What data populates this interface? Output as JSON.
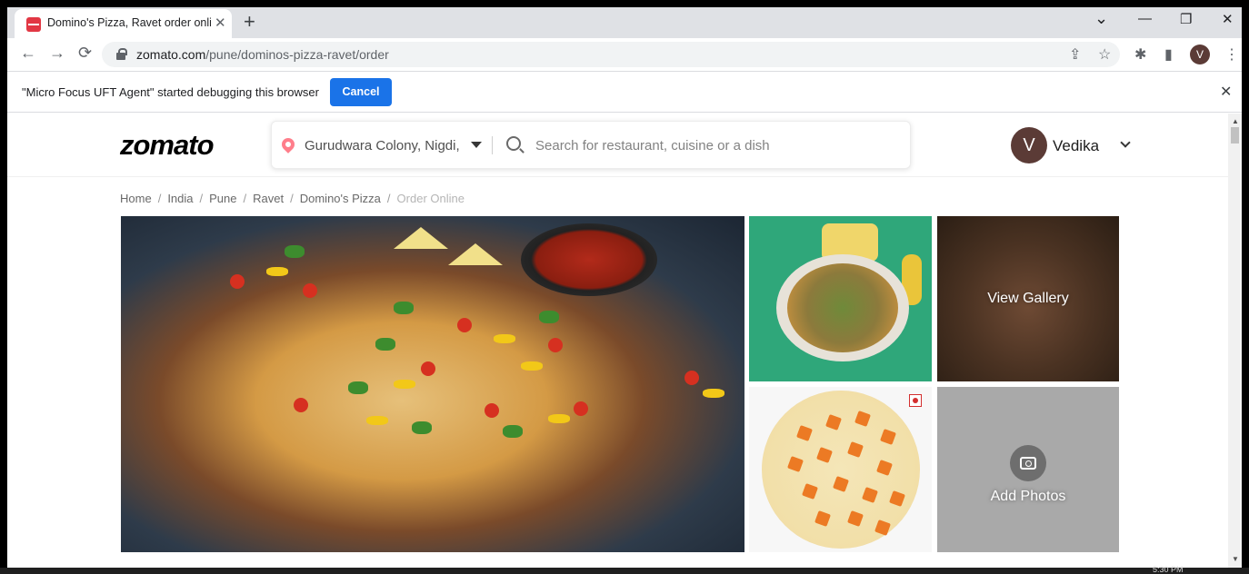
{
  "browser": {
    "tab_title": "Domino's Pizza, Ravet order online",
    "tab_close": "✕",
    "new_tab": "+",
    "window_controls": {
      "tab_search": "⌄",
      "minimize": "—",
      "restore": "❐",
      "close": "✕"
    },
    "nav": {
      "back": "←",
      "forward": "→",
      "reload": "⟳"
    },
    "url_host": "zomato.com",
    "url_path": "/pune/dominos-pizza-ravet/order",
    "toolbar_icons": [
      "share-icon",
      "bookmark-star-icon",
      "extensions-icon",
      "side-panel-icon",
      "profile-avatar",
      "menu-icon"
    ],
    "glyphs": {
      "share": "⇪",
      "star": "☆",
      "extensions": "✱",
      "side_panel": "▮",
      "menu": "⋮"
    },
    "profile_initial": "V"
  },
  "infobar": {
    "message": "\"Micro Focus UFT Agent\" started debugging this browser",
    "cancel_label": "Cancel",
    "close": "✕"
  },
  "site": {
    "logo": "zomato",
    "location": "Gurudwara Colony, Nigdi,",
    "search_placeholder": "Search for restaurant, cuisine or a dish",
    "user_initial": "V",
    "user_name": "Vedika",
    "brand_color": "#e23744"
  },
  "breadcrumb": {
    "items": [
      "Home",
      "India",
      "Pune",
      "Ravet",
      "Domino's Pizza"
    ],
    "current": "Order Online",
    "separator": "/"
  },
  "gallery": {
    "view_gallery_label": "View Gallery",
    "add_photos_label": "Add Photos"
  },
  "scrollbar": {
    "up": "▲",
    "down": "▼"
  },
  "taskbar": {
    "clock": "5:30 PM"
  }
}
